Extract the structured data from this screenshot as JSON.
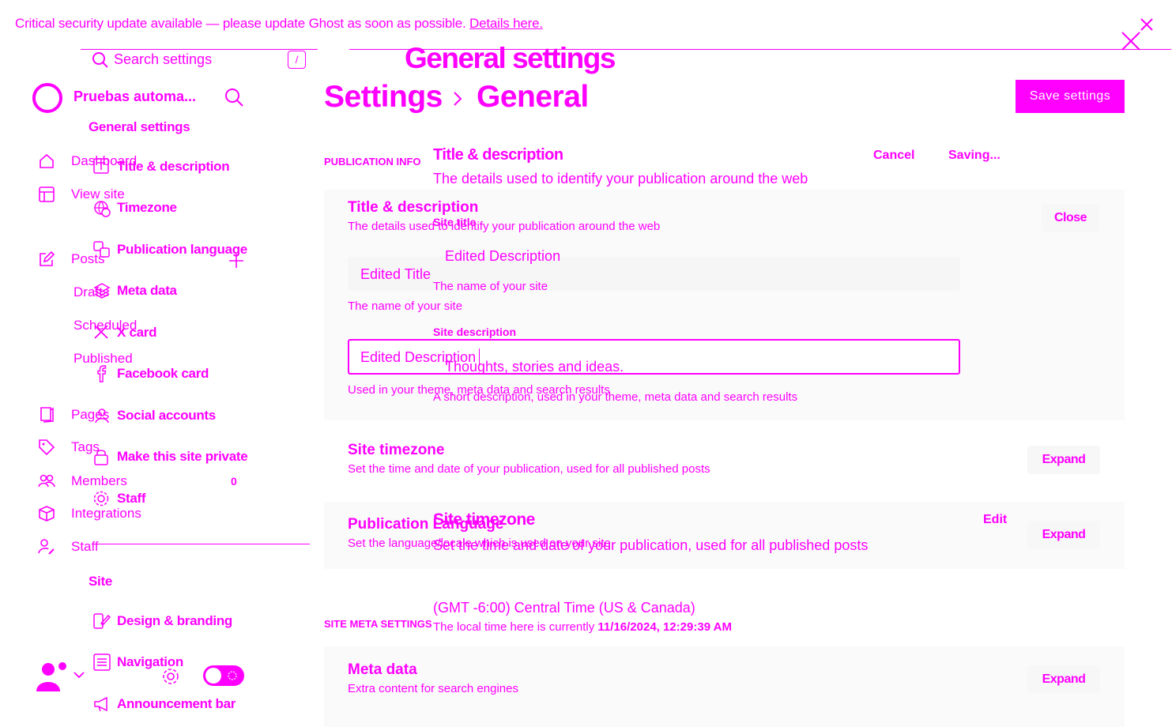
{
  "banner": {
    "text": "Critical security update available — please update Ghost as soon as possible.",
    "link": "Details here."
  },
  "overlay_heading": "General settings",
  "search": {
    "placeholder": "Search settings",
    "shortcut": "/"
  },
  "site": {
    "name": "Pruebas automa..."
  },
  "main_nav": [
    {
      "label": "Dashboard",
      "icon": "home-icon"
    },
    {
      "label": "View site",
      "icon": "layout-icon"
    },
    {
      "label": "Posts",
      "icon": "pen-icon"
    },
    {
      "label": "Drafts"
    },
    {
      "label": "Scheduled"
    },
    {
      "label": "Published"
    },
    {
      "label": "Pages",
      "icon": "page-icon"
    },
    {
      "label": "Tags",
      "icon": "tag-icon"
    },
    {
      "label": "Members",
      "icon": "members-icon",
      "count": "0"
    },
    {
      "label": "Integrations",
      "icon": "box-icon"
    },
    {
      "label": "Staff",
      "icon": "staff-icon"
    }
  ],
  "settings_nav": {
    "general_heading": "General settings",
    "general_items": [
      {
        "label": "Title & description",
        "icon": "text-icon"
      },
      {
        "label": "Timezone",
        "icon": "globe-clock-icon"
      },
      {
        "label": "Publication language",
        "icon": "language-icon"
      },
      {
        "label": "Meta data",
        "icon": "layers-icon"
      },
      {
        "label": "X card",
        "icon": "x-icon"
      },
      {
        "label": "Facebook card",
        "icon": "facebook-icon"
      },
      {
        "label": "Social accounts",
        "icon": "social-icon"
      },
      {
        "label": "Make this site private",
        "icon": "lock-icon"
      },
      {
        "label": "Staff",
        "icon": "staff-gear-icon"
      }
    ],
    "site_heading": "Site",
    "site_items": [
      {
        "label": "Design & branding",
        "icon": "brush-icon"
      },
      {
        "label": "Navigation",
        "icon": "navigation-icon"
      },
      {
        "label": "Announcement bar",
        "icon": "megaphone-icon"
      }
    ]
  },
  "breadcrumb": {
    "root": "Settings",
    "current": "General"
  },
  "save_button": "Save settings",
  "section_labels": {
    "publication_info": "PUBLICATION INFO",
    "site_meta": "SITE META SETTINGS"
  },
  "title_desc_card": {
    "title": "Title & description",
    "description": "The details used to identify your publication around the web",
    "close": "Close",
    "site_title_value": "Edited Title",
    "site_title_hint": "The name of your site",
    "site_description_value": "Edited Description",
    "site_description_hint": "Used in your theme, meta data and search results"
  },
  "overlay_card": {
    "title": "Title & description",
    "description": "The details used to identify your publication around the web",
    "cancel": "Cancel",
    "saving": "Saving...",
    "site_title_label": "Site title",
    "site_title_value": "Edited Description",
    "site_title_hint": "The name of your site",
    "site_description_label": "Site description",
    "site_description_value": "Thoughts, stories and ideas.",
    "site_description_hint": "A short description, used in your theme, meta data and search results"
  },
  "timezone_card": {
    "title": "Site timezone",
    "description": "Set the time and date of your publication, used for all published posts",
    "expand": "Expand"
  },
  "language_card": {
    "title": "Publication Language",
    "description": "Set the language/locale which is used on your site",
    "expand": "Expand"
  },
  "overlay_timezone": {
    "title": "Site timezone",
    "edit": "Edit",
    "description": "Set the time and date of your publication, used for all published posts",
    "value": "(GMT -6:00) Central Time (US & Canada)",
    "local_prefix": "The local time here is currently",
    "local_time": "11/16/2024, 12:29:39 AM"
  },
  "meta_card": {
    "title": "Meta data",
    "description": "Extra content for search engines",
    "expand": "Expand"
  },
  "colors": {
    "accent": "#ff00ff",
    "panel": "#fafafa"
  }
}
